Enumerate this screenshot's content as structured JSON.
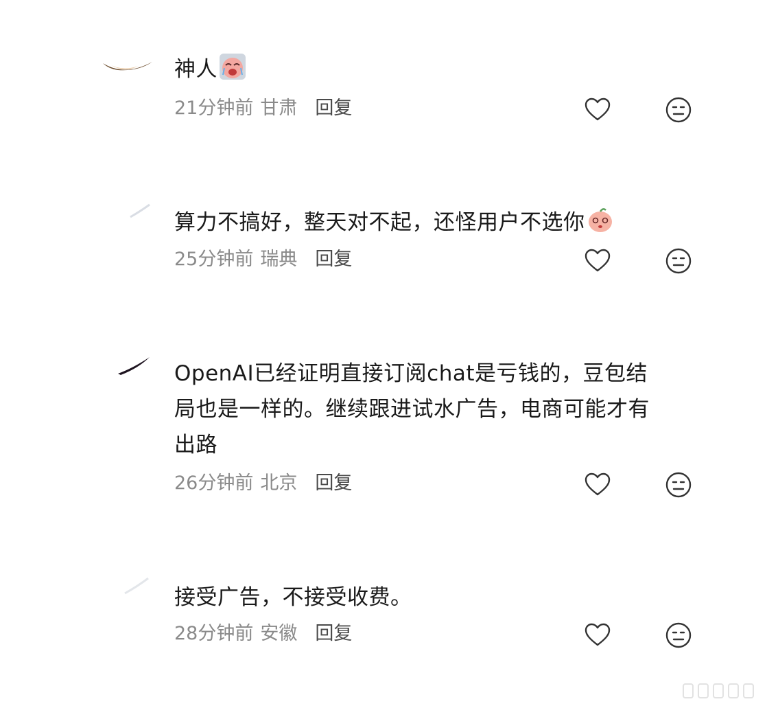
{
  "comments": [
    {
      "text": "神人",
      "emoji": "crying-face-emoji",
      "time": "21分钟前",
      "location": "甘肃",
      "reply_label": "回复"
    },
    {
      "text": "算力不搞好，整天对不起，还怪用户不选你",
      "emoji": "blushing-face-emoji",
      "time": "25分钟前",
      "location": "瑞典",
      "reply_label": "回复"
    },
    {
      "text_lines": [
        "OpenAI已经证明直接订阅chat是亏钱的，豆包结",
        "局也是一样的。继续跟进试水广告，电商可能才有",
        "出路"
      ],
      "time": "26分钟前",
      "location": "北京",
      "reply_label": "回复"
    },
    {
      "text": "接受广告，不接受收费。",
      "time": "28分钟前",
      "location": "安徽",
      "reply_label": "回复"
    }
  ],
  "icons": {
    "like": "heart-outline-icon",
    "dislike": "neutral-face-icon"
  },
  "colors": {
    "text": "#1a1a1a",
    "meta": "#8a8a8a",
    "icon": "#333333"
  }
}
